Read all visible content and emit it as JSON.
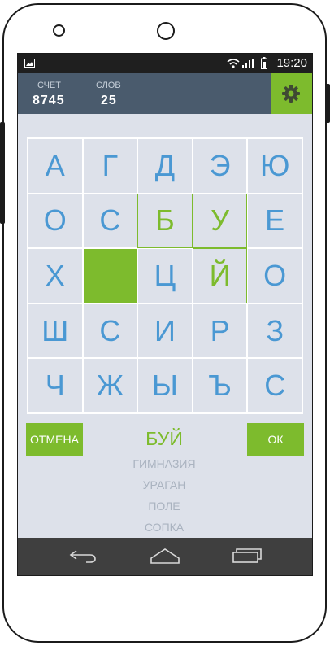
{
  "status_bar": {
    "time": "19:20"
  },
  "header": {
    "score_label": "СЧЕТ",
    "score_value": "8745",
    "words_label": "СЛОВ",
    "words_value": "25",
    "settings_icon": "gear-icon"
  },
  "grid": {
    "cells": [
      {
        "letter": "А",
        "state": "normal"
      },
      {
        "letter": "Г",
        "state": "normal"
      },
      {
        "letter": "Д",
        "state": "normal"
      },
      {
        "letter": "Э",
        "state": "normal"
      },
      {
        "letter": "Ю",
        "state": "normal"
      },
      {
        "letter": "О",
        "state": "normal"
      },
      {
        "letter": "С",
        "state": "normal"
      },
      {
        "letter": "Б",
        "state": "selected"
      },
      {
        "letter": "У",
        "state": "selected"
      },
      {
        "letter": "Е",
        "state": "normal"
      },
      {
        "letter": "Х",
        "state": "normal"
      },
      {
        "letter": "",
        "state": "filled"
      },
      {
        "letter": "Ц",
        "state": "normal"
      },
      {
        "letter": "Й",
        "state": "selected"
      },
      {
        "letter": "О",
        "state": "normal"
      },
      {
        "letter": "Ш",
        "state": "normal"
      },
      {
        "letter": "С",
        "state": "normal"
      },
      {
        "letter": "И",
        "state": "normal"
      },
      {
        "letter": "Р",
        "state": "normal"
      },
      {
        "letter": "З",
        "state": "normal"
      },
      {
        "letter": "Ч",
        "state": "normal"
      },
      {
        "letter": "Ж",
        "state": "normal"
      },
      {
        "letter": "Ы",
        "state": "normal"
      },
      {
        "letter": "Ъ",
        "state": "normal"
      },
      {
        "letter": "С",
        "state": "normal"
      }
    ]
  },
  "controls": {
    "cancel_label": "ОТМЕНА",
    "ok_label": "ОК",
    "current_word": "БУЙ"
  },
  "found_words": [
    "ГИМНАЗИЯ",
    "УРАГАН",
    "ПОЛЕ",
    "СОПКА"
  ],
  "colors": {
    "accent": "#7dbb2d",
    "letters": "#4a98d3",
    "header": "#4a5b6d",
    "background": "#dde1ea"
  },
  "nav_icons": [
    "back-icon",
    "home-icon",
    "recent-apps-icon"
  ]
}
